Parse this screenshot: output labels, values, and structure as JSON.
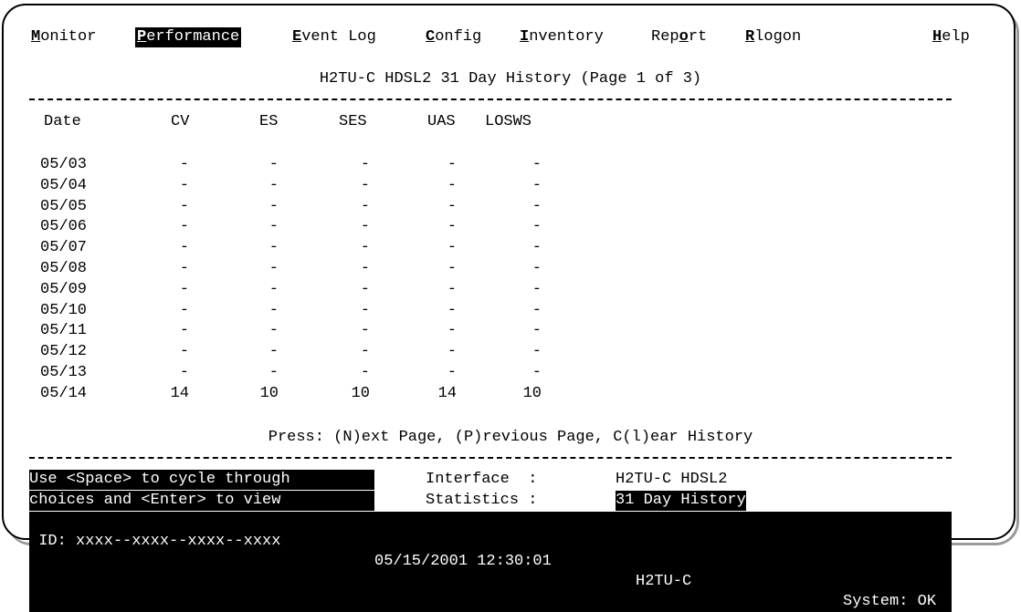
{
  "menu": [
    {
      "hotkey": "M",
      "rest": "onitor"
    },
    {
      "hotkey": "P",
      "rest": "erformance"
    },
    {
      "hotkey": "E",
      "rest": "vent Log"
    },
    {
      "hotkey": "C",
      "rest": "onfig"
    },
    {
      "hotkey": "I",
      "rest": "nventory"
    },
    {
      "pre": "Rep",
      "hotkey": "o",
      "rest": "rt"
    },
    {
      "hotkey": "R",
      "rest": "logon"
    },
    {
      "hotkey": "H",
      "rest": "elp"
    }
  ],
  "title": "H2TU-C HDSL2 31 Day History (Page 1 of 3)",
  "columns": [
    "Date",
    "CV",
    "ES",
    "SES",
    "UAS",
    "LOSWS"
  ],
  "rows": [
    [
      "05/03",
      "-",
      "-",
      "-",
      "-",
      "-"
    ],
    [
      "05/04",
      "-",
      "-",
      "-",
      "-",
      "-"
    ],
    [
      "05/05",
      "-",
      "-",
      "-",
      "-",
      "-"
    ],
    [
      "05/06",
      "-",
      "-",
      "-",
      "-",
      "-"
    ],
    [
      "05/07",
      "-",
      "-",
      "-",
      "-",
      "-"
    ],
    [
      "05/08",
      "-",
      "-",
      "-",
      "-",
      "-"
    ],
    [
      "05/09",
      "-",
      "-",
      "-",
      "-",
      "-"
    ],
    [
      "05/10",
      "-",
      "-",
      "-",
      "-",
      "-"
    ],
    [
      "05/11",
      "-",
      "-",
      "-",
      "-",
      "-"
    ],
    [
      "05/12",
      "-",
      "-",
      "-",
      "-",
      "-"
    ],
    [
      "05/13",
      "-",
      "-",
      "-",
      "-",
      "-"
    ],
    [
      "05/14",
      "14",
      "10",
      "10",
      "14",
      "10"
    ]
  ],
  "press": "Press: (N)ext Page, (P)revious Page, C(l)ear History",
  "hint": {
    "line1": "Use <Space> to cycle through",
    "line2": "choices and <Enter> to view"
  },
  "interface": {
    "label": "Interface  :",
    "value": "H2TU-C HDSL2"
  },
  "statistics": {
    "label": "Statistics :",
    "value": "31 Day History"
  },
  "status": {
    "id": " ID: xxxx--xxxx--xxxx--xxxx",
    "datetime": "05/15/2001 12:30:01",
    "unit": "H2TU-C",
    "system": "System: OK"
  }
}
